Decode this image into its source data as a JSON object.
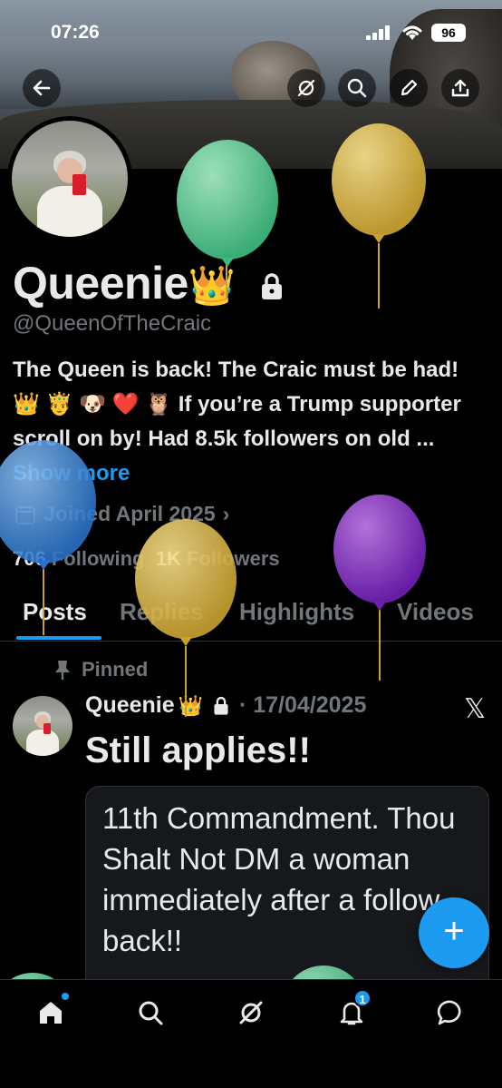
{
  "status_bar": {
    "time": "07:26",
    "battery": "96"
  },
  "profile": {
    "name": "Queenie",
    "name_emoji": "👑",
    "handle": "@QueenOfTheCraic",
    "bio": "The Queen is back! The Craic must be had! 👑 🤴 🐶 ❤️ 🦉  If you’re a Trump supporter scroll on by! Had 8.5k followers on old ...",
    "show_more": "Show more",
    "joined": "Joined April 2025",
    "following_count": "706",
    "following_label": "Following",
    "followers_count": "1K",
    "followers_label": "Followers"
  },
  "tabs": [
    "Posts",
    "Replies",
    "Highlights",
    "Videos"
  ],
  "post": {
    "pinned_label": "Pinned",
    "author": "Queenie",
    "author_emoji": "👑",
    "date": "· 17/04/2025",
    "text": "Still applies!!",
    "quote_text": "11th Commandment. Thou Shalt Not DM a woman immediately after a follow back!!"
  },
  "fab_label": "+",
  "bottom_nav": {
    "notifications_badge": "1"
  },
  "icons": {
    "back": "back-arrow-icon",
    "grok": "grok-icon",
    "search": "search-icon",
    "edit": "pencil-icon",
    "share": "share-icon",
    "lock": "lock-icon",
    "calendar": "calendar-icon",
    "pin": "pin-icon",
    "x": "x-logo-icon",
    "home": "home-icon",
    "notifications": "bell-icon",
    "messages": "message-icon"
  },
  "colors": {
    "accent": "#1d9bf0",
    "balloon_green": "#5fd49a",
    "balloon_yellow": "#e6c24c",
    "balloon_blue": "#3f8fe0",
    "balloon_purple": "#8e33d0"
  }
}
